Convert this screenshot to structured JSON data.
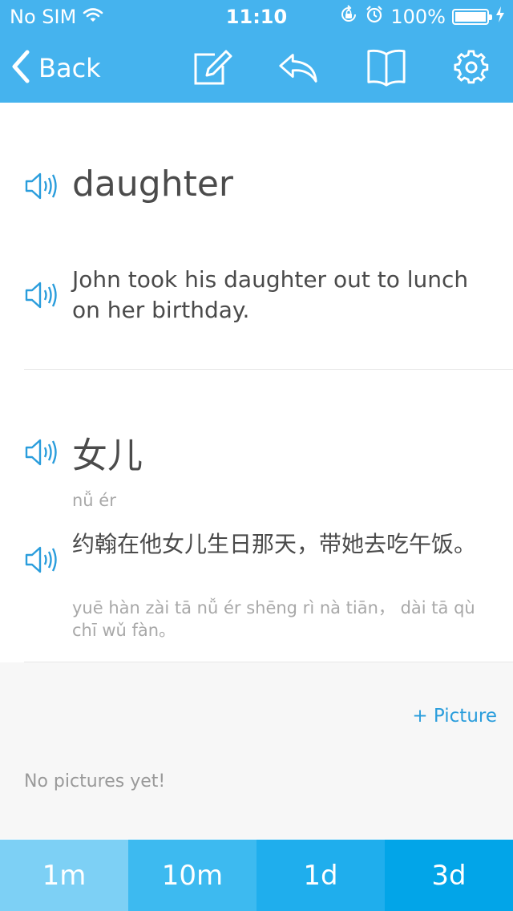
{
  "status_bar": {
    "carrier": "No SIM",
    "time": "11:10",
    "battery": "100%",
    "battery_level": 1.0
  },
  "nav": {
    "back_label": "Back",
    "icons": [
      "edit-icon",
      "reply-icon",
      "book-icon",
      "gear-icon"
    ]
  },
  "card": {
    "word": "daughter",
    "example": "John took his daughter out to lunch on her birthday.",
    "translation": "女儿",
    "translation_pinyin": "nǚ ér",
    "translated_example": "约翰在他女儿生日那天，带她去吃午饭。",
    "translated_example_pinyin": "yuē hàn zài tā nǚ ér shēng rì nà tiān， dài tā qù chī wǔ fàn。"
  },
  "pictures": {
    "add_label": "+ Picture",
    "empty_label": "No pictures yet!"
  },
  "intervals": [
    {
      "label": "1m",
      "color": "#7dd0f5"
    },
    {
      "label": "10m",
      "color": "#3dbaf0"
    },
    {
      "label": "1d",
      "color": "#1faeed"
    },
    {
      "label": "3d",
      "color": "#02a5e8"
    }
  ],
  "colors": {
    "accent": "#45b3ee",
    "speaker": "#2a9ddc",
    "link": "#2a9ddc"
  }
}
